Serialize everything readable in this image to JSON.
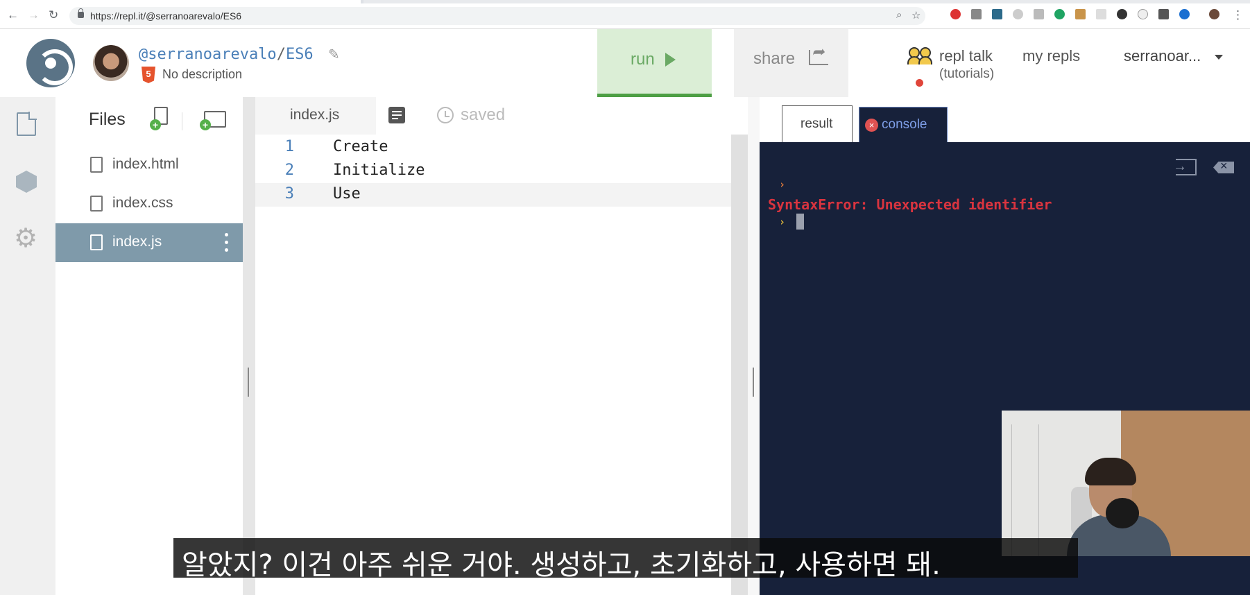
{
  "browser": {
    "url": "https://repl.it/@serranoarevalo/ES6",
    "back_icon": "←",
    "forward_icon": "→",
    "reload_icon": "↻",
    "zoom_icon": "⌕",
    "star_icon": "☆",
    "menu_icon": "⋮"
  },
  "header": {
    "owner": "@serranoarevalo",
    "separator": "/",
    "repl_name": "ES6",
    "html5_badge": "5",
    "description": "No description",
    "run_label": "run",
    "share_label": "share",
    "repl_talk_label": "repl talk",
    "tutorials_label": "(tutorials)",
    "my_repls_label": "my repls",
    "username": "serranoar..."
  },
  "files_panel": {
    "title": "Files",
    "add_symbol": "+",
    "items": [
      {
        "name": "index.html",
        "active": false
      },
      {
        "name": "index.css",
        "active": false
      },
      {
        "name": "index.js",
        "active": true
      }
    ]
  },
  "editor": {
    "tab_label": "index.js",
    "saved_label": "saved",
    "lines": [
      {
        "number": "1",
        "text": "Create"
      },
      {
        "number": "2",
        "text": "Initialize"
      },
      {
        "number": "3",
        "text": "Use"
      }
    ]
  },
  "output": {
    "result_tab": "result",
    "console_tab": "console",
    "close_symbol": "×",
    "prompt_symbol": "›",
    "error_text": "SyntaxError: Unexpected identifier"
  },
  "subtitle": "알았지? 이건 아주 쉬운 거야. 생성하고, 초기화하고, 사용하면 돼.",
  "colors": {
    "run_bg": "#dbeed6",
    "run_accent": "#4e9f45",
    "console_bg": "#17213a",
    "error_red": "#d9343f",
    "active_file_bg": "#7f9aaa",
    "link_blue": "#4a7fb8"
  }
}
